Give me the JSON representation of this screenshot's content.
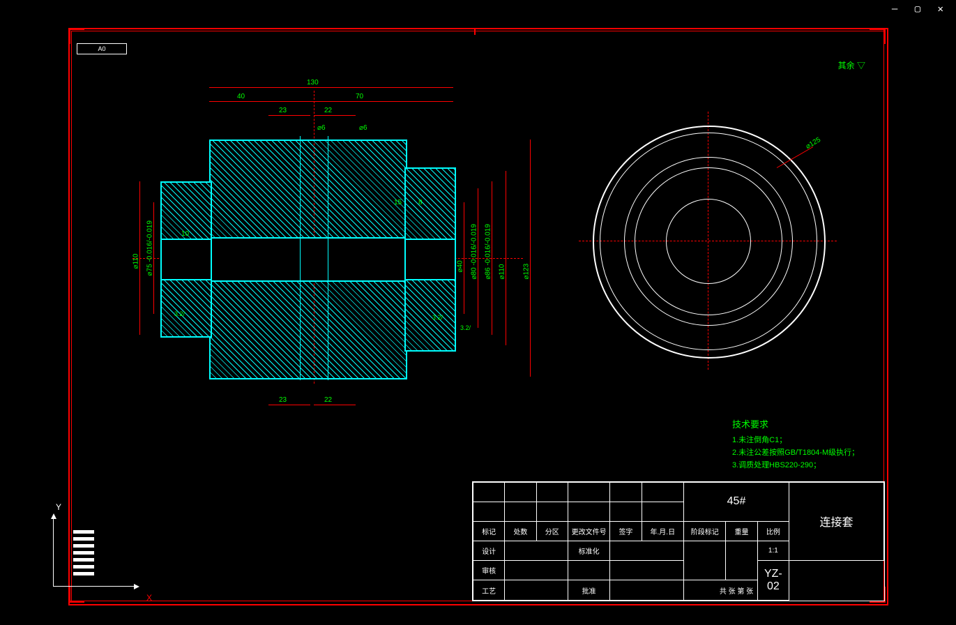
{
  "frame": {
    "size_label": "A0"
  },
  "window_controls": "— ▢ ✕",
  "axes": {
    "y": "Y",
    "x": "X"
  },
  "note_top": "其余 ▽",
  "dimensions": {
    "d130": "130",
    "d40": "40",
    "d70": "70",
    "d23a": "23",
    "d22a": "22",
    "d23b": "23",
    "d22b": "22",
    "phi6a": "⌀6",
    "phi6b": "⌀6",
    "d15": "15",
    "d8": "8",
    "d10": "10",
    "phi110a": "⌀110",
    "phi110b": "⌀110",
    "phi123": "⌀123",
    "phi125": "⌀125",
    "phi75": "⌀75 -0.016/-0.019",
    "phi40": "⌀40",
    "phi80": "⌀80 -0.016/-0.019",
    "phi86": "⌀86 -0.016/-0.019",
    "surf32a": "3.2/",
    "surf32b": "3.2/",
    "surf32c": "3.2/"
  },
  "tech_req": {
    "title": "技术要求",
    "line1": "1.未注倒角C1；",
    "line2": "2.未注公差按照GB/T1804-M级执行；",
    "line3": "3.调质处理HBS220-290；"
  },
  "title_block": {
    "material": "45#",
    "part_name": "连接套",
    "drawing_no": "YZ-02",
    "scale": "1:1",
    "headers": {
      "mark": "标记",
      "count": "处数",
      "zone": "分区",
      "file": "更改文件号",
      "sign": "签字",
      "date": "年.月.日",
      "design": "设计",
      "standardize": "标准化",
      "check": "审核",
      "approve": "批准",
      "process": "工艺",
      "stage": "阶段标记",
      "weight": "重量",
      "ratio": "比例",
      "sheet": "共  张  第  张"
    }
  }
}
